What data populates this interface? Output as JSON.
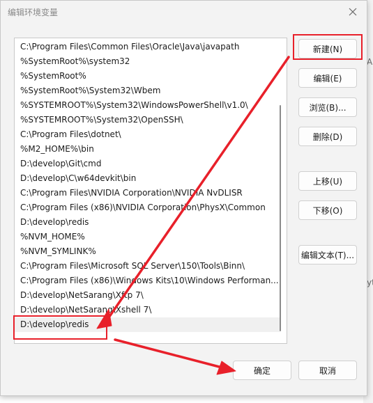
{
  "window": {
    "title": "编辑环境变量"
  },
  "path_entries": [
    "C:\\Program Files\\Common Files\\Oracle\\Java\\javapath",
    "%SystemRoot%\\system32",
    "%SystemRoot%",
    "%SystemRoot%\\System32\\Wbem",
    "%SYSTEMROOT%\\System32\\WindowsPowerShell\\v1.0\\",
    "%SYSTEMROOT%\\System32\\OpenSSH\\",
    "C:\\Program Files\\dotnet\\",
    "%M2_HOME%\\bin",
    "D:\\develop\\Git\\cmd",
    "D:\\develop\\C\\w64devkit\\bin",
    "C:\\Program Files\\NVIDIA Corporation\\NVIDIA NvDLISR",
    "C:\\Program Files (x86)\\NVIDIA Corporation\\PhysX\\Common",
    "D:\\develop\\redis",
    "%NVM_HOME%",
    "%NVM_SYMLINK%",
    "C:\\Program Files\\Microsoft SQL Server\\150\\Tools\\Binn\\",
    "C:\\Program Files (x86)\\Windows Kits\\10\\Windows Performan...",
    "D:\\develop\\NetSarang\\Xftp 7\\",
    "D:\\develop\\NetSarang\\Xshell 7\\",
    "D:\\develop\\redis"
  ],
  "buttons": {
    "new": "新建(N)",
    "edit": "编辑(E)",
    "browse": "浏览(B)...",
    "delete": "删除(D)",
    "move_up": "上移(U)",
    "move_down": "下移(O)",
    "edit_text": "编辑文本(T)...",
    "ok": "确定",
    "cancel": "取消"
  },
  "background_fragments": {
    "a": "Ap",
    "b": "yt"
  },
  "colors": {
    "annotation_red": "#e8202a",
    "dialog_bg": "#f3f3f3"
  },
  "icons": {
    "close": "close-icon"
  }
}
